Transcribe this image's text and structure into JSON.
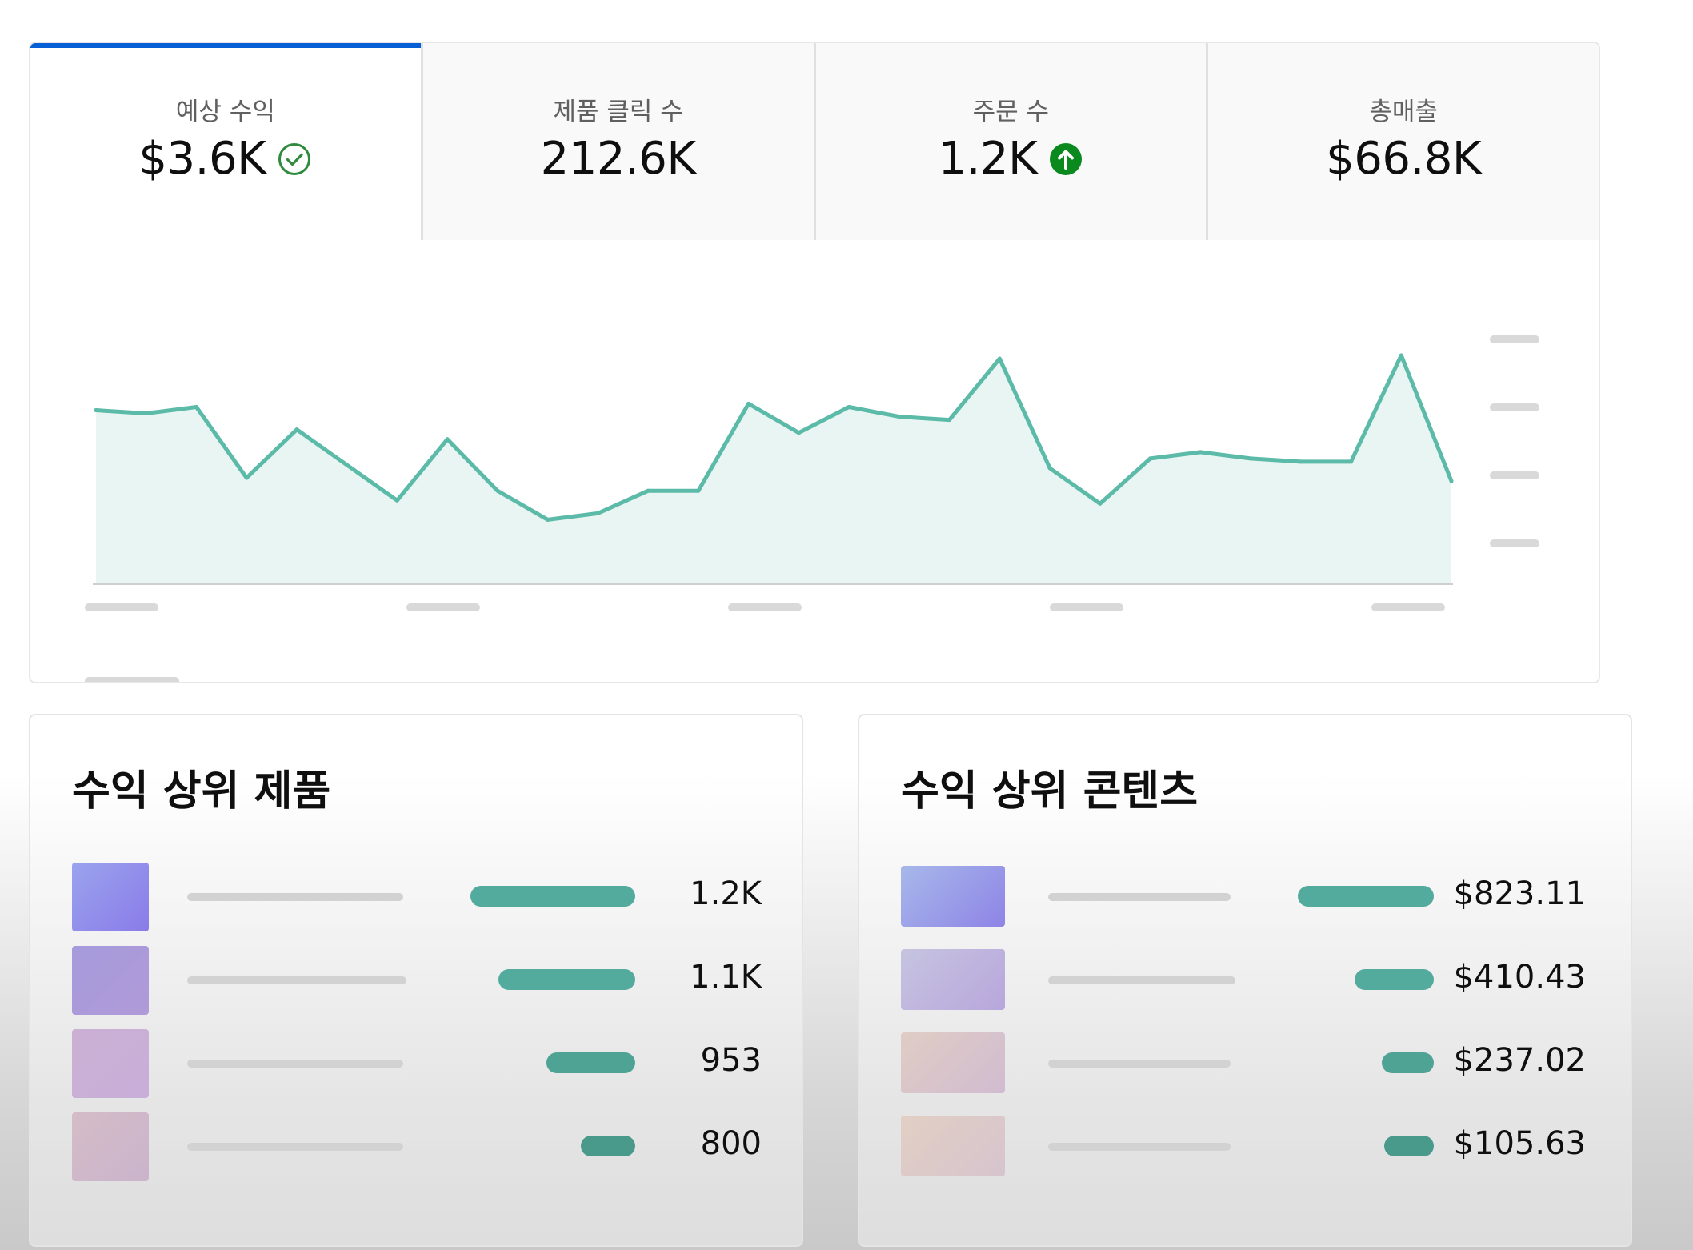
{
  "metric_tabs": [
    {
      "label": "예상 수익",
      "value": "$3.6K",
      "icon": "check-circle-icon",
      "icon_color": "#2e8b3e",
      "selected": true
    },
    {
      "label": "제품 클릭 수",
      "value": "212.6K",
      "icon": "",
      "selected": false
    },
    {
      "label": "주문 수",
      "value": "1.2K",
      "icon": "arrow-up-circle-icon",
      "icon_color": "#0a8a1e",
      "selected": false
    },
    {
      "label": "총매출",
      "value": "$66.8K",
      "icon": "",
      "selected": false
    }
  ],
  "colors": {
    "accent": "#065fd4",
    "line": "#5bbaa8",
    "area": "#e8f5f2",
    "bar_teal": "#52ab9c",
    "placeholder": "#d8d8d8"
  },
  "chart_data": {
    "type": "area",
    "x": [
      0,
      1,
      2,
      3,
      4,
      5,
      6,
      7,
      8,
      9,
      10,
      11,
      12,
      13,
      14,
      15,
      16,
      17,
      18,
      19,
      20,
      21,
      22,
      23,
      24,
      25,
      26,
      27
    ],
    "series": [
      {
        "values": [
          54,
          53,
          55,
          33,
          48,
          37,
          26,
          45,
          29,
          20,
          22,
          29,
          29,
          56,
          47,
          55,
          52,
          51,
          70,
          36,
          25,
          39,
          41,
          39,
          38,
          38,
          71,
          32
        ]
      }
    ],
    "ylim": [
      0,
      72
    ],
    "axis_labels": "placeholder-skeleton",
    "y_tick_count": 4,
    "x_tick_count": 5,
    "grid": false
  },
  "top_products": {
    "title": "수익 상위 제품",
    "rows": [
      {
        "value": "1.2K",
        "fraction": 1.0,
        "thumb_from": "#9aa3ee",
        "thumb_to": "#8a7be8"
      },
      {
        "value": "1.1K",
        "fraction": 0.83,
        "thumb_from": "#a69bdc",
        "thumb_to": "#b09ad8"
      },
      {
        "value": "953",
        "fraction": 0.54,
        "thumb_from": "#cbb0d4",
        "thumb_to": "#c8aed8"
      },
      {
        "value": "800",
        "fraction": 0.33,
        "thumb_from": "#d4bcc6",
        "thumb_to": "#cab4cc"
      }
    ]
  },
  "top_content": {
    "title": "수익 상위 콘텐츠",
    "rows": [
      {
        "value": "$823.11",
        "fraction": 1.0,
        "thumb_from": "#a7b8ea",
        "thumb_to": "#8e84e6"
      },
      {
        "value": "$410.43",
        "fraction": 0.58,
        "thumb_from": "#c6c4e0",
        "thumb_to": "#b8a6dc"
      },
      {
        "value": "$237.02",
        "fraction": 0.38,
        "thumb_from": "#e0ccc4",
        "thumb_to": "#d0bcd0"
      },
      {
        "value": "$105.63",
        "fraction": 0.22,
        "thumb_from": "#e2cfc4",
        "thumb_to": "#d6c4ce"
      }
    ]
  }
}
